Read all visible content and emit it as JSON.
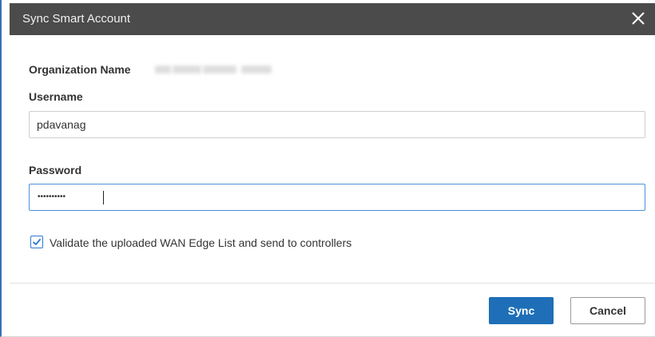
{
  "dialog": {
    "title": "Sync Smart Account"
  },
  "form": {
    "org_label": "Organization Name",
    "username_label": "Username",
    "username_value": "pdavanag",
    "password_label": "Password",
    "password_mask": "••••••••••",
    "validate_label": "Validate the uploaded WAN Edge List and send to controllers",
    "validate_checked": true
  },
  "buttons": {
    "sync_label": "Sync",
    "cancel_label": "Cancel"
  },
  "icons": {
    "close": "close-icon",
    "check": "checkmark-icon"
  },
  "colors": {
    "titlebar": "#4b4b4b",
    "primary": "#1e6fb8",
    "focus_border": "#4a90d9",
    "checkbox": "#2f7bd1"
  }
}
